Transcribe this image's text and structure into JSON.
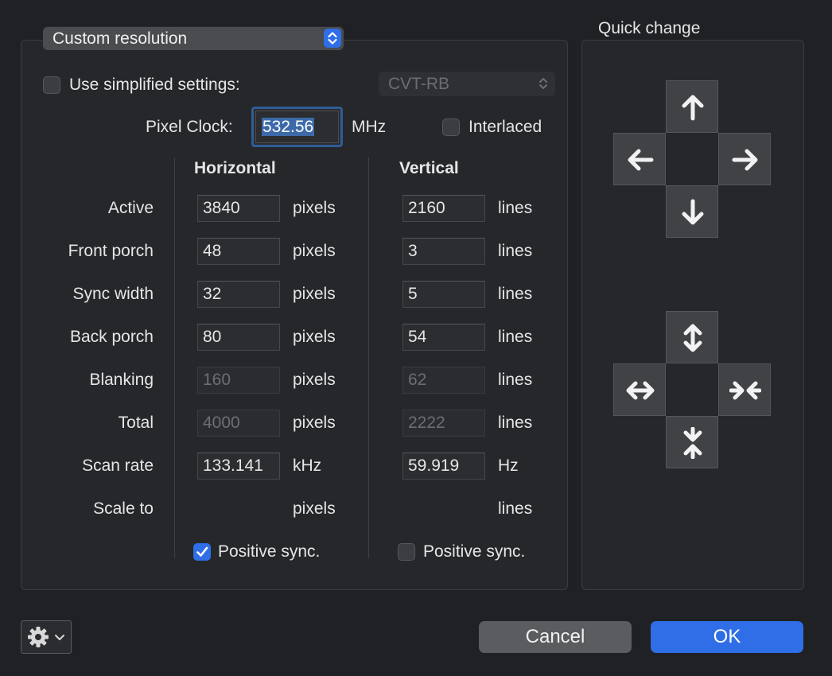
{
  "header": {
    "resolution_popup": "Custom resolution",
    "quick_change_title": "Quick change"
  },
  "settings": {
    "simplified_label": "Use simplified settings:",
    "simplified_checked": false,
    "timing_select": "CVT-RB",
    "pixel_clock_label": "Pixel Clock:",
    "pixel_clock_value": "532.56",
    "pixel_clock_unit": "MHz",
    "interlaced_label": "Interlaced",
    "interlaced_checked": false
  },
  "columns": {
    "horizontal": "Horizontal",
    "vertical": "Vertical"
  },
  "rows": [
    {
      "label": "Active",
      "h": "3840",
      "h_unit": "pixels",
      "v": "2160",
      "v_unit": "lines",
      "editable": true
    },
    {
      "label": "Front porch",
      "h": "48",
      "h_unit": "pixels",
      "v": "3",
      "v_unit": "lines",
      "editable": true
    },
    {
      "label": "Sync width",
      "h": "32",
      "h_unit": "pixels",
      "v": "5",
      "v_unit": "lines",
      "editable": true
    },
    {
      "label": "Back porch",
      "h": "80",
      "h_unit": "pixels",
      "v": "54",
      "v_unit": "lines",
      "editable": true
    },
    {
      "label": "Blanking",
      "h": "160",
      "h_unit": "pixels",
      "v": "62",
      "v_unit": "lines",
      "editable": false
    },
    {
      "label": "Total",
      "h": "4000",
      "h_unit": "pixels",
      "v": "2222",
      "v_unit": "lines",
      "editable": false
    },
    {
      "label": "Scan rate",
      "h": "133.141",
      "h_unit": "kHz",
      "v": "59.919",
      "v_unit": "Hz",
      "editable": true
    },
    {
      "label": "Scale to",
      "h": "",
      "h_unit": "pixels",
      "v": "",
      "v_unit": "lines",
      "editable": false
    }
  ],
  "sync": {
    "h_label": "Positive sync.",
    "h_checked": true,
    "v_label": "Positive sync.",
    "v_checked": false
  },
  "quick_change": {
    "move_icons": [
      "arrow-up-icon",
      "arrow-left-icon",
      "arrow-right-icon",
      "arrow-down-icon"
    ],
    "resize_icons": [
      "expand-vertical-icon",
      "expand-horizontal-icon",
      "shrink-horizontal-icon",
      "shrink-vertical-icon"
    ]
  },
  "footer": {
    "cancel_label": "Cancel",
    "ok_label": "OK",
    "gear_icon": "gear-icon"
  },
  "colors": {
    "accent": "#2f6ee6",
    "background": "#1f2125"
  }
}
